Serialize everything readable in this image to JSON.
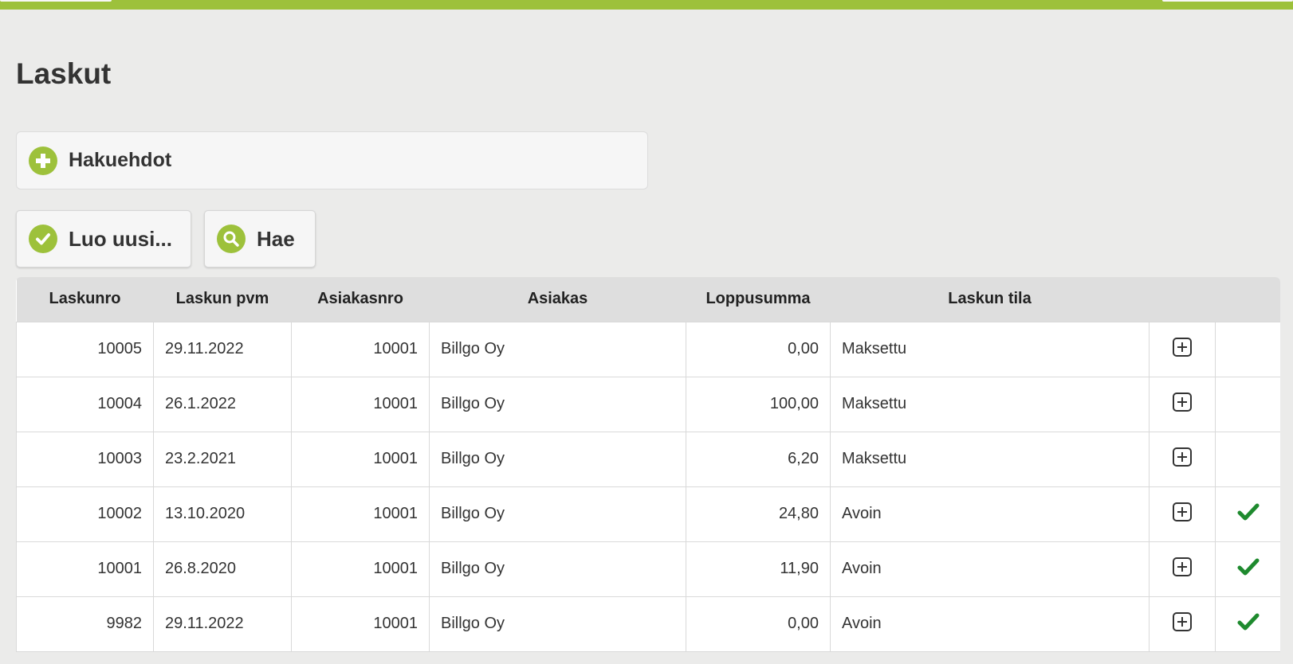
{
  "page": {
    "title": "Laskut"
  },
  "search_panel": {
    "label": "Hakuehdot",
    "icon": "plus-circle-icon"
  },
  "buttons": {
    "new_label": "Luo uusi...",
    "new_icon": "check-circle-icon",
    "search_label": "Hae",
    "search_icon": "magnifier-icon"
  },
  "colors": {
    "accent": "#9dc13b",
    "check": "#1e8a2e",
    "background": "#ebebea"
  },
  "table": {
    "headers": [
      "Laskunro",
      "Laskun pvm",
      "Asiakasnro",
      "Asiakas",
      "Loppusumma",
      "Laskun tila"
    ],
    "rows": [
      {
        "invoice_no": "10005",
        "date": "29.11.2022",
        "customer_no": "10001",
        "customer": "Billgo Oy",
        "total": "0,00",
        "status": "Maksettu",
        "open": false
      },
      {
        "invoice_no": "10004",
        "date": "26.1.2022",
        "customer_no": "10001",
        "customer": "Billgo Oy",
        "total": "100,00",
        "status": "Maksettu",
        "open": false
      },
      {
        "invoice_no": "10003",
        "date": "23.2.2021",
        "customer_no": "10001",
        "customer": "Billgo Oy",
        "total": "6,20",
        "status": "Maksettu",
        "open": false
      },
      {
        "invoice_no": "10002",
        "date": "13.10.2020",
        "customer_no": "10001",
        "customer": "Billgo Oy",
        "total": "24,80",
        "status": "Avoin",
        "open": true
      },
      {
        "invoice_no": "10001",
        "date": "26.8.2020",
        "customer_no": "10001",
        "customer": "Billgo Oy",
        "total": "11,90",
        "status": "Avoin",
        "open": true
      },
      {
        "invoice_no": "9982",
        "date": "29.11.2022",
        "customer_no": "10001",
        "customer": "Billgo Oy",
        "total": "0,00",
        "status": "Avoin",
        "open": true
      }
    ]
  }
}
